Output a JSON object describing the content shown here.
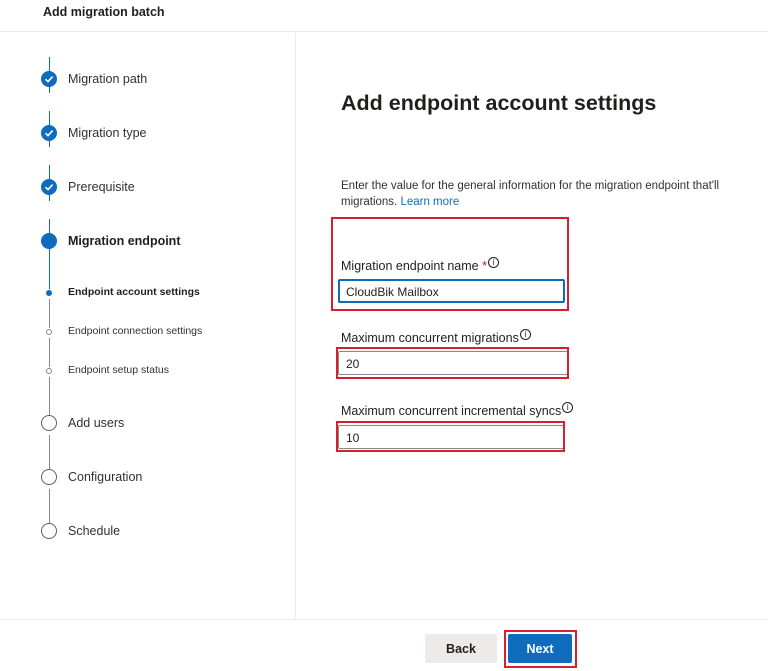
{
  "header": {
    "title": "Add migration batch"
  },
  "sidebar": {
    "steps": [
      {
        "label": "Migration path",
        "state": "done"
      },
      {
        "label": "Migration type",
        "state": "done"
      },
      {
        "label": "Prerequisite",
        "state": "done"
      },
      {
        "label": "Migration endpoint",
        "state": "current"
      },
      {
        "label": "Add users",
        "state": "todo"
      },
      {
        "label": "Configuration",
        "state": "todo"
      },
      {
        "label": "Schedule",
        "state": "todo"
      }
    ],
    "substeps": [
      {
        "label": "Endpoint account settings",
        "state": "current"
      },
      {
        "label": "Endpoint connection settings",
        "state": "todo"
      },
      {
        "label": "Endpoint setup status",
        "state": "todo"
      }
    ]
  },
  "main": {
    "title": "Add endpoint account settings",
    "description": "Enter the value for the general information for the migration endpoint that'll",
    "description_cont": "migrations.",
    "learn_more": "Learn more",
    "fields": [
      {
        "label": "Migration endpoint name",
        "required_mark": "*",
        "value": "CloudBik Mailbox"
      },
      {
        "label": "Maximum concurrent migrations",
        "value": "20"
      },
      {
        "label": "Maximum concurrent incremental syncs",
        "value": "10"
      }
    ],
    "info_glyph": "i"
  },
  "footer": {
    "back_label": "Back",
    "next_label": "Next"
  },
  "colors": {
    "accent": "#0f6cbd",
    "highlight": "#d62032"
  }
}
